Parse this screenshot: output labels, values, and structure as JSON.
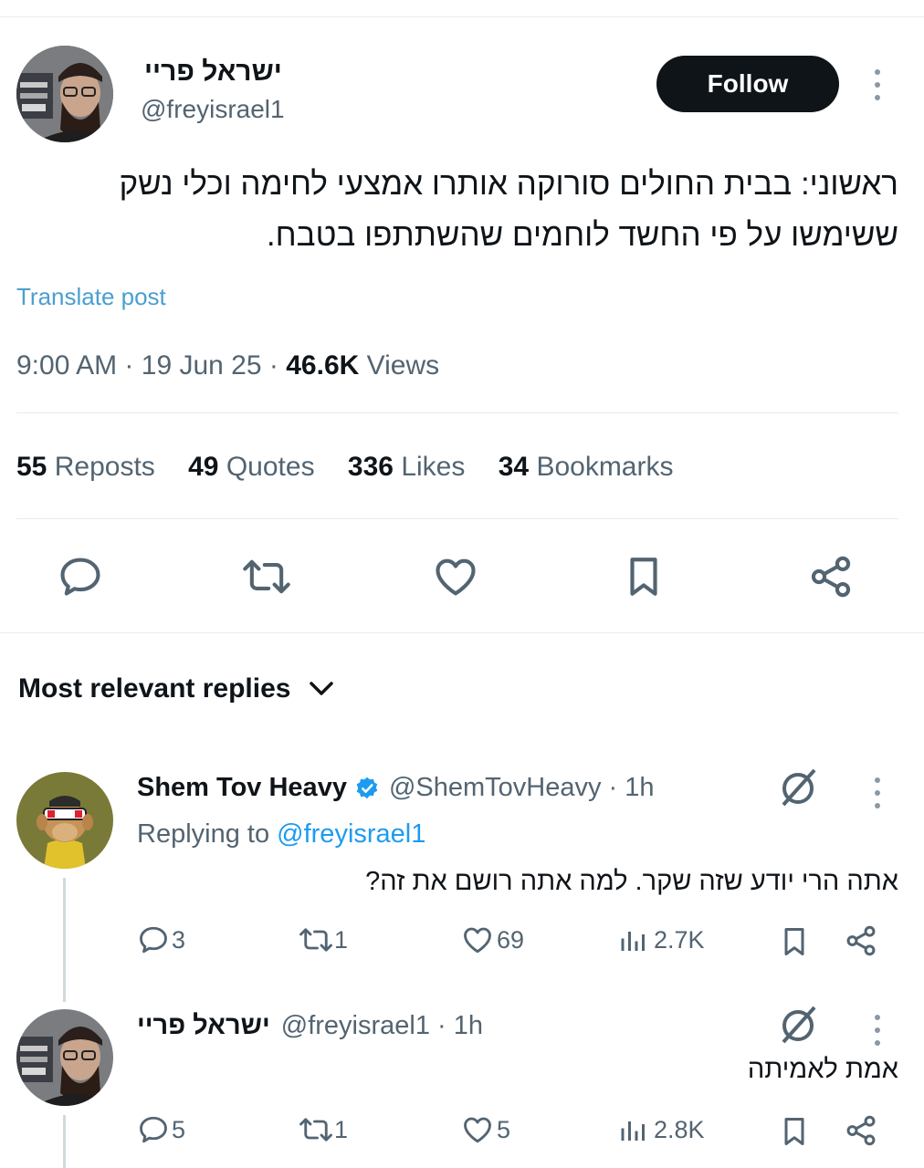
{
  "post": {
    "author_name": "ישראל פריי",
    "author_handle": "@freyisrael1",
    "follow_label": "Follow",
    "text_line1": "ראשוני: בבית החולים סורוקה אותרו אמצעי לחימה וכלי נשק",
    "text_line2": "ששימשו על פי החשד לוחמים שהשתתפו בטבח.",
    "translate_label": "Translate post",
    "time": "9:00 AM",
    "date": "19 Jun 25",
    "views_count": "46.6K",
    "views_label": "Views",
    "sep1": "·",
    "sep2": "·",
    "stats": [
      {
        "count": "55",
        "label": "Reposts"
      },
      {
        "count": "49",
        "label": "Quotes"
      },
      {
        "count": "336",
        "label": "Likes"
      },
      {
        "count": "34",
        "label": "Bookmarks"
      }
    ]
  },
  "replies_header": {
    "label": "Most relevant replies"
  },
  "replies": [
    {
      "name": "Shem Tov Heavy",
      "handle": "@ShemTovHeavy",
      "time": "· 1h",
      "replying_prefix": "Replying to",
      "replying_to": "@freyisrael1",
      "text": "אתה הרי יודע שזה שקר. למה אתה רושם את זה?",
      "replies": "3",
      "reposts": "1",
      "likes": "69",
      "views": "2.7K"
    },
    {
      "name": "ישראל פריי",
      "handle": "@freyisrael1",
      "time": "· 1h",
      "text": "אמת לאמיתה",
      "replies": "5",
      "reposts": "1",
      "likes": "5",
      "views": "2.8K"
    }
  ],
  "colors": {
    "accent": "#1d9bf0",
    "translate": "#4a9fd0",
    "text": "#0f1419",
    "muted": "#536471",
    "verified": "#1d9bf0"
  }
}
